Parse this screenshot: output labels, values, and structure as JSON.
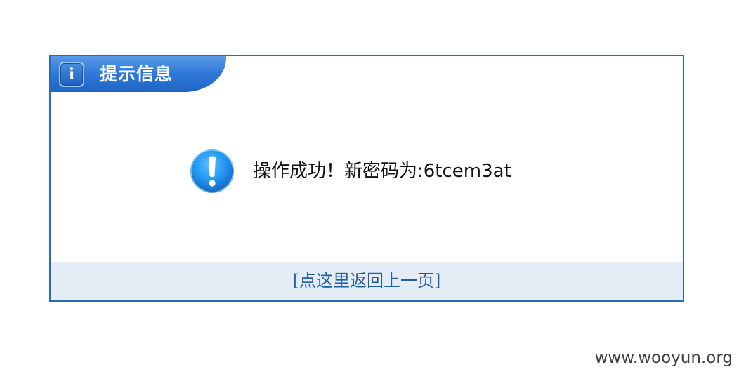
{
  "dialog": {
    "title": "提示信息",
    "info_icon_glyph": "i",
    "info_icon_name": "info-icon",
    "alert_icon_name": "exclamation-icon",
    "message": "操作成功！新密码为:6tcem3at",
    "back_link": "[点这里返回上一页]"
  },
  "watermark": "www.wooyun.org",
  "colors": {
    "border": "#2a6bb8",
    "header_blue": "#2f78d8",
    "link": "#1f5f9e",
    "footer_bg": "#e6ecf5",
    "alert_blue": "#1e88e5"
  }
}
